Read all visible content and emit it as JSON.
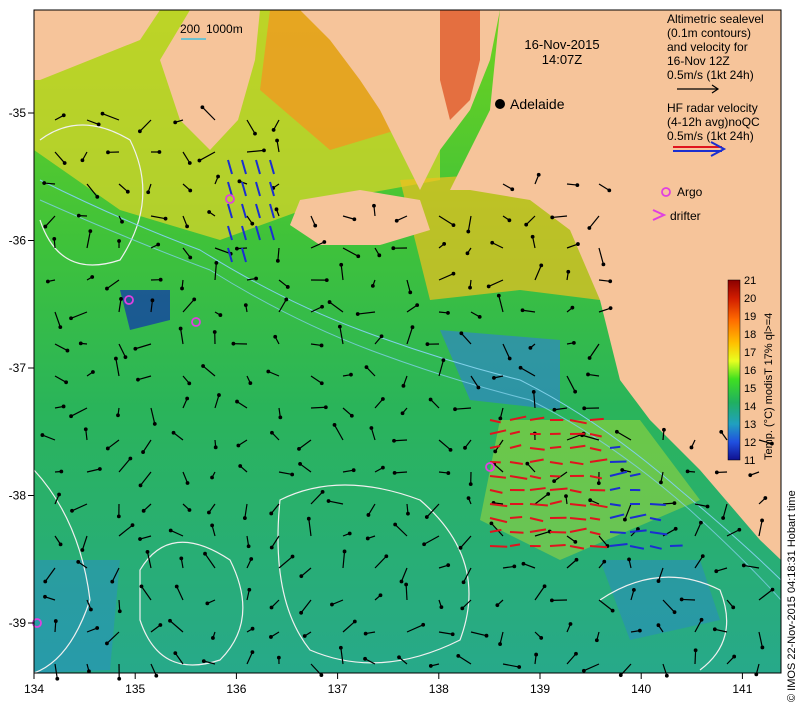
{
  "date": "16-Nov-2015",
  "time": "14:07Z",
  "scale_bar": {
    "iso200": "200",
    "iso1000": "1000m"
  },
  "city": {
    "name": "Adelaide"
  },
  "legend": {
    "altimetric": [
      "Altimetric sealevel",
      "(0.1m contours)",
      "and velocity for",
      "16-Nov 12Z",
      "0.5m/s (1kt 24h)"
    ],
    "hf": [
      "HF radar velocity",
      "(4-12h avg)noQC",
      "0.5m/s (1kt 24h)"
    ],
    "argo": "Argo",
    "drifter": "drifter"
  },
  "colorbar": {
    "label": "Temp. (°C) modisT 17% ql>=4",
    "ticks": [
      "21",
      "20",
      "19",
      "18",
      "17",
      "16",
      "15",
      "14",
      "13",
      "12",
      "11"
    ]
  },
  "lon_ticks": [
    "134",
    "135",
    "136",
    "137",
    "138",
    "139",
    "140",
    "141"
  ],
  "lat_ticks": [
    "-35",
    "-36",
    "-37",
    "-38",
    "-39"
  ],
  "credit": "© IMOS 22-Nov-2015 04:18:31 Hobart time",
  "colors": {
    "land": "#f6c49a",
    "hf_arrow": "#e0141e",
    "hf_arrow2": "#1a2fd0",
    "argo": "#e040e0"
  }
}
